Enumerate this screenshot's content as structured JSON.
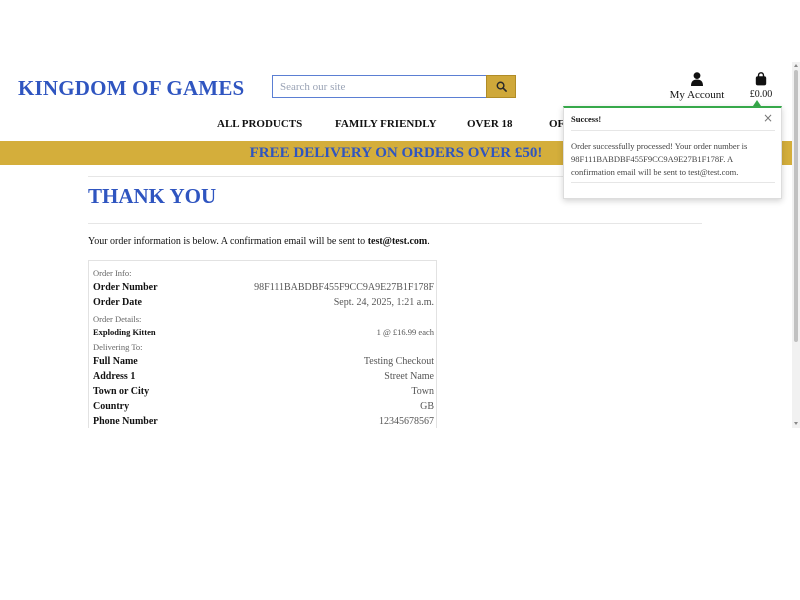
{
  "header": {
    "logo": "KINGDOM OF GAMES",
    "search_placeholder": "Search our site",
    "account_label": "My Account",
    "basket_total": "£0.00"
  },
  "nav": {
    "items": [
      "ALL PRODUCTS",
      "FAMILY FRIENDLY",
      "OVER 18",
      "OF"
    ]
  },
  "banner": {
    "text": "FREE DELIVERY ON ORDERS OVER £50!"
  },
  "main": {
    "title": "THANK YOU",
    "intro_prefix": "Your order information is below. A confirmation email will be sent to ",
    "intro_email": "test@test.com",
    "intro_suffix": "."
  },
  "order": {
    "order_info_heading": "Order Info:",
    "order_number_label": "Order Number",
    "order_number": "98F111BABDBF455F9CC9A9E27B1F178F",
    "order_date_label": "Order Date",
    "order_date": "Sept. 24, 2025, 1:21 a.m.",
    "order_details_heading": "Order Details:",
    "item_name": "Exploding Kitten",
    "item_qty": "1 @ £16.99 each",
    "delivering_heading": "Delivering To:",
    "full_name_label": "Full Name",
    "full_name": "Testing Checkout",
    "address1_label": "Address 1",
    "address1": "Street Name",
    "town_label": "Town or City",
    "town": "Town",
    "country_label": "Country",
    "country": "GB",
    "phone_label": "Phone Number",
    "phone": "12345678567"
  },
  "toast": {
    "title": "Success!",
    "close": "×",
    "message": "Order successfully processed! Your order number is 98F111BABDBF455F9CC9A9E27B1F178F. A confirmation email will be sent to test@test.com.",
    "accent_color": "#36a84a"
  },
  "colors": {
    "brand_blue": "#2f55c0",
    "gold": "#d4ae3b"
  }
}
